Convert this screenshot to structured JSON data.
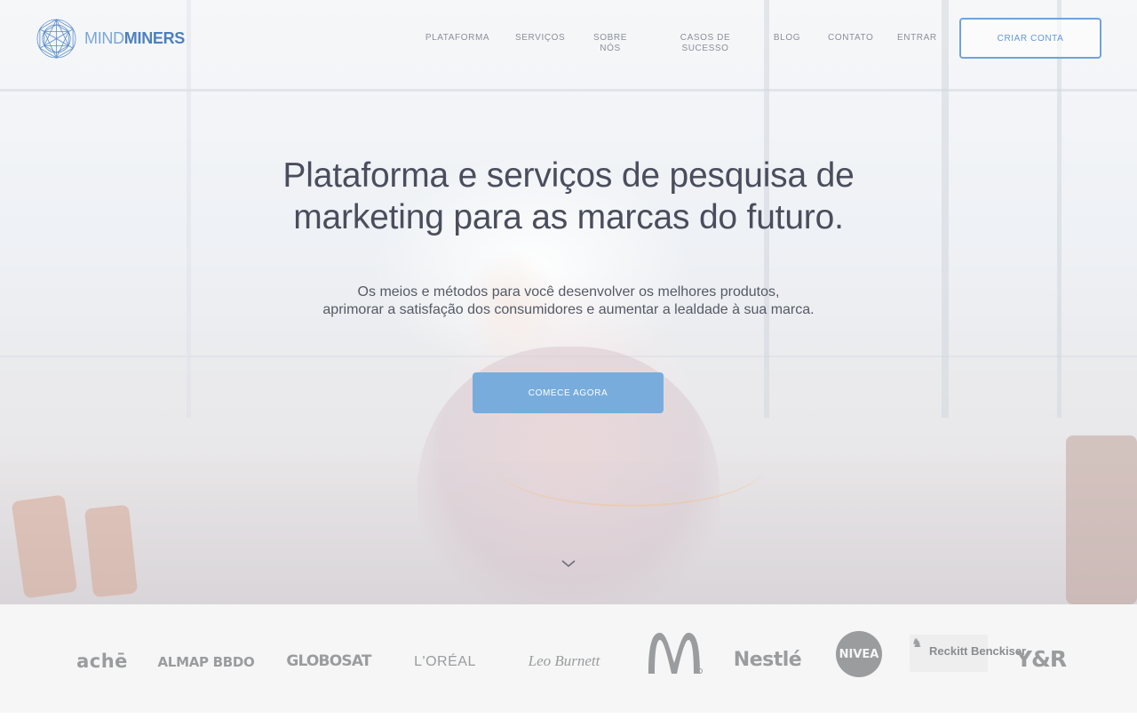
{
  "brand": {
    "name_light": "MIND",
    "name_bold": "MINERS",
    "logo_icon": "geodesic-globe-icon",
    "color": "#4d80bd"
  },
  "nav": {
    "items": [
      {
        "label": "PLATAFORMA"
      },
      {
        "label": "SERVIÇOS"
      },
      {
        "label": "SOBRE NÓS"
      },
      {
        "label": "CASOS DE SUCESSO"
      },
      {
        "label": "BLOG"
      },
      {
        "label": "CONTATO"
      },
      {
        "label": "ENTRAR"
      }
    ],
    "signup_label": "CRIAR CONTA"
  },
  "hero": {
    "headline": "Plataforma e serviços de pesquisa de marketing para as marcas do futuro.",
    "subline_1": "Os meios e métodos para você desenvolver os melhores produtos,",
    "subline_2": "aprimorar a satisfação dos consumidores e aumentar a lealdade à sua marca.",
    "cta_label": "COMECE AGORA",
    "scroll_icon": "chevron-down-icon",
    "accent_color": "#78acdd"
  },
  "clients": [
    {
      "name": "achē"
    },
    {
      "name": "ALMAP BBDO"
    },
    {
      "name": "GLOBOSAT"
    },
    {
      "name": "L'ORÉAL"
    },
    {
      "name": "Leo Burnett"
    },
    {
      "name": "McDonald's"
    },
    {
      "name": "Nestlé"
    },
    {
      "name": "NIVEA"
    },
    {
      "name": "Reckitt Benckiser"
    },
    {
      "name": "Y&R"
    }
  ]
}
